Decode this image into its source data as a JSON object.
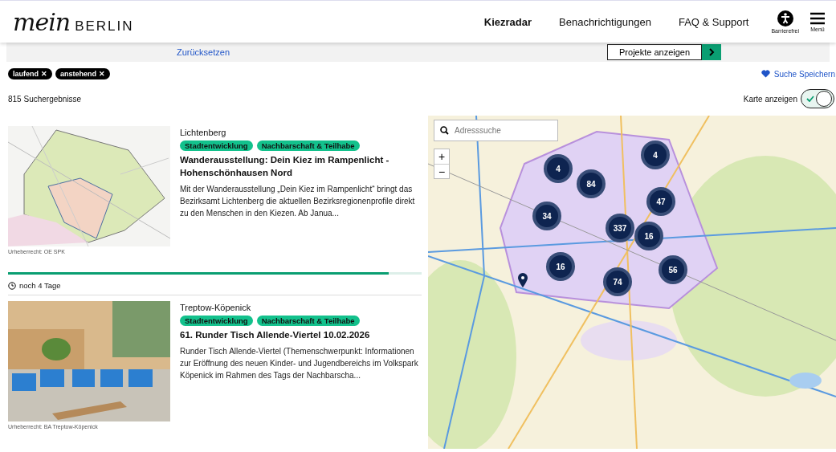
{
  "header": {
    "logo_script": "mein",
    "logo_word": "BERLIN",
    "nav": [
      {
        "label": "Kiezradar",
        "selected": true
      },
      {
        "label": "Benachrichtigungen",
        "selected": false
      },
      {
        "label": "FAQ & Support",
        "selected": false
      }
    ],
    "accessibility": "Barrierefrei",
    "menu": "Menü"
  },
  "filter_bar": {
    "reset": "Zurücksetzen",
    "submit": "Projekte anzeigen"
  },
  "chips": [
    {
      "label": "laufend",
      "remove": "✕"
    },
    {
      "label": "anstehend",
      "remove": "✕"
    }
  ],
  "save_search": "Suche Speichern",
  "result_count": "815 Suchergebnisse",
  "map_toggle": {
    "label": "Karte anzeigen",
    "on": true
  },
  "results": [
    {
      "district": "Lichtenberg",
      "tags": [
        "Stadtentwicklung",
        "Nachbarschaft & Teilhabe"
      ],
      "title": "Wanderausstellung: Dein Kiez im Rampenlicht - Hohenschönhausen Nord",
      "teaser": "Mit der Wanderausstellung „Dein Kiez im Rampenlicht“ bringt das Bezirksamt Lichtenberg die aktuellen Bezirksregionenprofile direkt zu den Menschen in den Kiezen. Ab Janua...",
      "copyright": "Urheberrecht: OE SPK",
      "progress": {
        "level": 0.92,
        "remaining": "noch 4 Tage"
      }
    },
    {
      "district": "Treptow-Köpenick",
      "tags": [
        "Stadtentwicklung",
        "Nachbarschaft & Teilhabe"
      ],
      "title": "61. Runder Tisch Allende-Viertel 10.02.2026",
      "teaser": "Runder Tisch Allende-Viertel (Themenschwerpunkt: Informationen zur Eröffnung des neuen Kinder- und Jugendbereichs im Volkspark Köpenick im Rahmen des Tags der Nachbarscha...",
      "copyright": "Urheberrecht: BA Treptow-Köpenick"
    }
  ],
  "map": {
    "search_placeholder": "Adresssuche",
    "zoom_in": "+",
    "zoom_out": "−",
    "clusters": [
      "4",
      "4",
      "84",
      "47",
      "34",
      "337",
      "16",
      "16",
      "56",
      "74"
    ]
  }
}
